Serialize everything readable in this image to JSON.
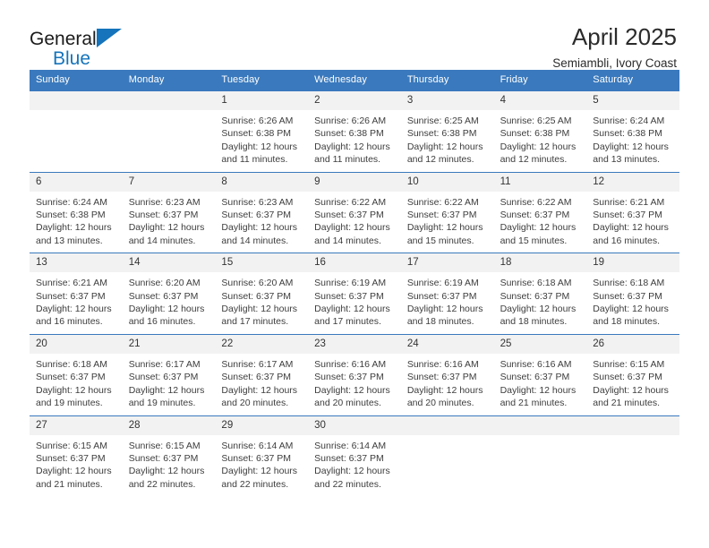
{
  "brand": {
    "name_top": "General",
    "name_bottom": "Blue",
    "triangle_color": "#1574bb"
  },
  "header": {
    "title": "April 2025",
    "subtitle": "Semiambli, Ivory Coast"
  },
  "theme": {
    "header_blue": "#3a79bd",
    "daynum_band": "#f2f2f2",
    "text": "#3d3d3d"
  },
  "weekdays": [
    "Sunday",
    "Monday",
    "Tuesday",
    "Wednesday",
    "Thursday",
    "Friday",
    "Saturday"
  ],
  "weeks": [
    {
      "days": [
        {
          "num": "",
          "sunrise": "",
          "sunset": "",
          "daylight1": "",
          "daylight2": ""
        },
        {
          "num": "",
          "sunrise": "",
          "sunset": "",
          "daylight1": "",
          "daylight2": ""
        },
        {
          "num": "1",
          "sunrise": "Sunrise: 6:26 AM",
          "sunset": "Sunset: 6:38 PM",
          "daylight1": "Daylight: 12 hours",
          "daylight2": "and 11 minutes."
        },
        {
          "num": "2",
          "sunrise": "Sunrise: 6:26 AM",
          "sunset": "Sunset: 6:38 PM",
          "daylight1": "Daylight: 12 hours",
          "daylight2": "and 11 minutes."
        },
        {
          "num": "3",
          "sunrise": "Sunrise: 6:25 AM",
          "sunset": "Sunset: 6:38 PM",
          "daylight1": "Daylight: 12 hours",
          "daylight2": "and 12 minutes."
        },
        {
          "num": "4",
          "sunrise": "Sunrise: 6:25 AM",
          "sunset": "Sunset: 6:38 PM",
          "daylight1": "Daylight: 12 hours",
          "daylight2": "and 12 minutes."
        },
        {
          "num": "5",
          "sunrise": "Sunrise: 6:24 AM",
          "sunset": "Sunset: 6:38 PM",
          "daylight1": "Daylight: 12 hours",
          "daylight2": "and 13 minutes."
        }
      ]
    },
    {
      "days": [
        {
          "num": "6",
          "sunrise": "Sunrise: 6:24 AM",
          "sunset": "Sunset: 6:38 PM",
          "daylight1": "Daylight: 12 hours",
          "daylight2": "and 13 minutes."
        },
        {
          "num": "7",
          "sunrise": "Sunrise: 6:23 AM",
          "sunset": "Sunset: 6:37 PM",
          "daylight1": "Daylight: 12 hours",
          "daylight2": "and 14 minutes."
        },
        {
          "num": "8",
          "sunrise": "Sunrise: 6:23 AM",
          "sunset": "Sunset: 6:37 PM",
          "daylight1": "Daylight: 12 hours",
          "daylight2": "and 14 minutes."
        },
        {
          "num": "9",
          "sunrise": "Sunrise: 6:22 AM",
          "sunset": "Sunset: 6:37 PM",
          "daylight1": "Daylight: 12 hours",
          "daylight2": "and 14 minutes."
        },
        {
          "num": "10",
          "sunrise": "Sunrise: 6:22 AM",
          "sunset": "Sunset: 6:37 PM",
          "daylight1": "Daylight: 12 hours",
          "daylight2": "and 15 minutes."
        },
        {
          "num": "11",
          "sunrise": "Sunrise: 6:22 AM",
          "sunset": "Sunset: 6:37 PM",
          "daylight1": "Daylight: 12 hours",
          "daylight2": "and 15 minutes."
        },
        {
          "num": "12",
          "sunrise": "Sunrise: 6:21 AM",
          "sunset": "Sunset: 6:37 PM",
          "daylight1": "Daylight: 12 hours",
          "daylight2": "and 16 minutes."
        }
      ]
    },
    {
      "days": [
        {
          "num": "13",
          "sunrise": "Sunrise: 6:21 AM",
          "sunset": "Sunset: 6:37 PM",
          "daylight1": "Daylight: 12 hours",
          "daylight2": "and 16 minutes."
        },
        {
          "num": "14",
          "sunrise": "Sunrise: 6:20 AM",
          "sunset": "Sunset: 6:37 PM",
          "daylight1": "Daylight: 12 hours",
          "daylight2": "and 16 minutes."
        },
        {
          "num": "15",
          "sunrise": "Sunrise: 6:20 AM",
          "sunset": "Sunset: 6:37 PM",
          "daylight1": "Daylight: 12 hours",
          "daylight2": "and 17 minutes."
        },
        {
          "num": "16",
          "sunrise": "Sunrise: 6:19 AM",
          "sunset": "Sunset: 6:37 PM",
          "daylight1": "Daylight: 12 hours",
          "daylight2": "and 17 minutes."
        },
        {
          "num": "17",
          "sunrise": "Sunrise: 6:19 AM",
          "sunset": "Sunset: 6:37 PM",
          "daylight1": "Daylight: 12 hours",
          "daylight2": "and 18 minutes."
        },
        {
          "num": "18",
          "sunrise": "Sunrise: 6:18 AM",
          "sunset": "Sunset: 6:37 PM",
          "daylight1": "Daylight: 12 hours",
          "daylight2": "and 18 minutes."
        },
        {
          "num": "19",
          "sunrise": "Sunrise: 6:18 AM",
          "sunset": "Sunset: 6:37 PM",
          "daylight1": "Daylight: 12 hours",
          "daylight2": "and 18 minutes."
        }
      ]
    },
    {
      "days": [
        {
          "num": "20",
          "sunrise": "Sunrise: 6:18 AM",
          "sunset": "Sunset: 6:37 PM",
          "daylight1": "Daylight: 12 hours",
          "daylight2": "and 19 minutes."
        },
        {
          "num": "21",
          "sunrise": "Sunrise: 6:17 AM",
          "sunset": "Sunset: 6:37 PM",
          "daylight1": "Daylight: 12 hours",
          "daylight2": "and 19 minutes."
        },
        {
          "num": "22",
          "sunrise": "Sunrise: 6:17 AM",
          "sunset": "Sunset: 6:37 PM",
          "daylight1": "Daylight: 12 hours",
          "daylight2": "and 20 minutes."
        },
        {
          "num": "23",
          "sunrise": "Sunrise: 6:16 AM",
          "sunset": "Sunset: 6:37 PM",
          "daylight1": "Daylight: 12 hours",
          "daylight2": "and 20 minutes."
        },
        {
          "num": "24",
          "sunrise": "Sunrise: 6:16 AM",
          "sunset": "Sunset: 6:37 PM",
          "daylight1": "Daylight: 12 hours",
          "daylight2": "and 20 minutes."
        },
        {
          "num": "25",
          "sunrise": "Sunrise: 6:16 AM",
          "sunset": "Sunset: 6:37 PM",
          "daylight1": "Daylight: 12 hours",
          "daylight2": "and 21 minutes."
        },
        {
          "num": "26",
          "sunrise": "Sunrise: 6:15 AM",
          "sunset": "Sunset: 6:37 PM",
          "daylight1": "Daylight: 12 hours",
          "daylight2": "and 21 minutes."
        }
      ]
    },
    {
      "days": [
        {
          "num": "27",
          "sunrise": "Sunrise: 6:15 AM",
          "sunset": "Sunset: 6:37 PM",
          "daylight1": "Daylight: 12 hours",
          "daylight2": "and 21 minutes."
        },
        {
          "num": "28",
          "sunrise": "Sunrise: 6:15 AM",
          "sunset": "Sunset: 6:37 PM",
          "daylight1": "Daylight: 12 hours",
          "daylight2": "and 22 minutes."
        },
        {
          "num": "29",
          "sunrise": "Sunrise: 6:14 AM",
          "sunset": "Sunset: 6:37 PM",
          "daylight1": "Daylight: 12 hours",
          "daylight2": "and 22 minutes."
        },
        {
          "num": "30",
          "sunrise": "Sunrise: 6:14 AM",
          "sunset": "Sunset: 6:37 PM",
          "daylight1": "Daylight: 12 hours",
          "daylight2": "and 22 minutes."
        },
        {
          "num": "",
          "sunrise": "",
          "sunset": "",
          "daylight1": "",
          "daylight2": ""
        },
        {
          "num": "",
          "sunrise": "",
          "sunset": "",
          "daylight1": "",
          "daylight2": ""
        },
        {
          "num": "",
          "sunrise": "",
          "sunset": "",
          "daylight1": "",
          "daylight2": ""
        }
      ]
    }
  ]
}
